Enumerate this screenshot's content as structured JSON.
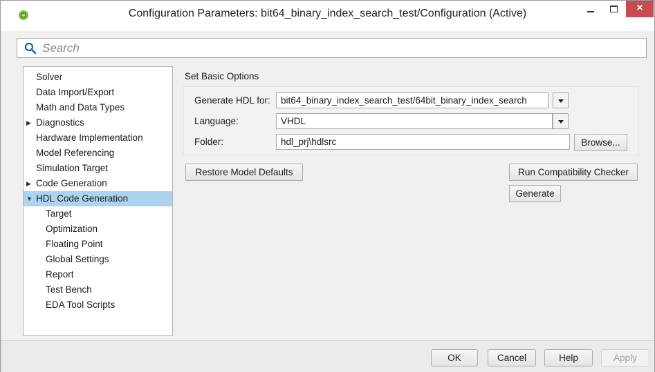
{
  "window": {
    "title": "Configuration Parameters: bit64_binary_index_search_test/Configuration (Active)",
    "close_glyph": "×"
  },
  "search": {
    "placeholder": "Search"
  },
  "tree": {
    "items": [
      {
        "label": "Solver"
      },
      {
        "label": "Data Import/Export"
      },
      {
        "label": "Math and Data Types"
      },
      {
        "label": "Diagnostics"
      },
      {
        "label": "Hardware Implementation"
      },
      {
        "label": "Model Referencing"
      },
      {
        "label": "Simulation Target"
      },
      {
        "label": "Code Generation"
      },
      {
        "label": "HDL Code Generation"
      },
      {
        "label": "Target"
      },
      {
        "label": "Optimization"
      },
      {
        "label": "Floating Point"
      },
      {
        "label": "Global Settings"
      },
      {
        "label": "Report"
      },
      {
        "label": "Test Bench"
      },
      {
        "label": "EDA Tool Scripts"
      }
    ]
  },
  "basic_options": {
    "title": "Set Basic Options",
    "generate_hdl_for_label": "Generate HDL for:",
    "generate_hdl_for_value": "bit64_binary_index_search_test/64bit_binary_index_search",
    "language_label": "Language:",
    "language_value": "VHDL",
    "folder_label": "Folder:",
    "folder_value": "hdl_prj\\hdlsrc",
    "browse_label": "Browse..."
  },
  "actions": {
    "restore_defaults": "Restore Model Defaults",
    "run_checker": "Run Compatibility Checker",
    "generate": "Generate"
  },
  "footer": {
    "ok": "OK",
    "cancel": "Cancel",
    "help": "Help",
    "apply": "Apply"
  },
  "colors": {
    "selection": "#acd4f1",
    "close_button": "#c74b50"
  }
}
